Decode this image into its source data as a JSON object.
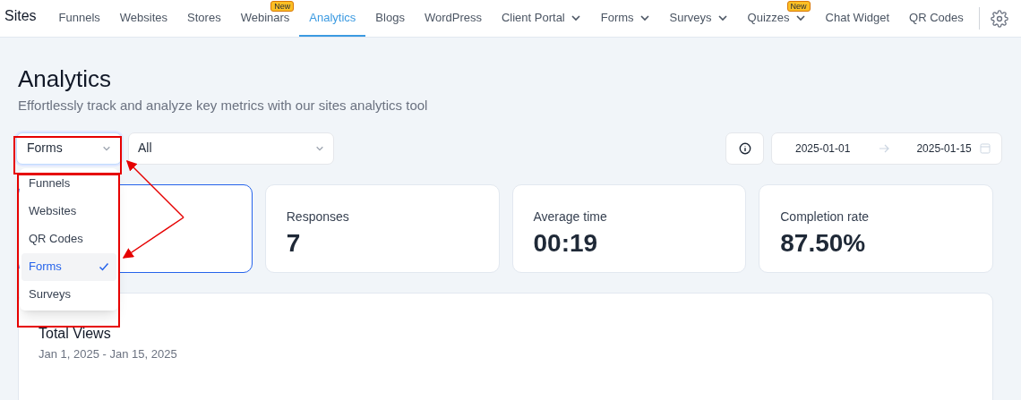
{
  "nav": {
    "brand": "Sites",
    "items": [
      {
        "label": "Funnels",
        "selected": false,
        "dropdown": false
      },
      {
        "label": "Websites",
        "selected": false,
        "dropdown": false
      },
      {
        "label": "Stores",
        "selected": false,
        "dropdown": false
      },
      {
        "label": "Webinars",
        "selected": false,
        "dropdown": false,
        "badge": "New"
      },
      {
        "label": "Analytics",
        "selected": true,
        "dropdown": false
      },
      {
        "label": "Blogs",
        "selected": false,
        "dropdown": false
      },
      {
        "label": "WordPress",
        "selected": false,
        "dropdown": false
      },
      {
        "label": "Client Portal",
        "selected": false,
        "dropdown": true
      },
      {
        "label": "Forms",
        "selected": false,
        "dropdown": true
      },
      {
        "label": "Surveys",
        "selected": false,
        "dropdown": true
      },
      {
        "label": "Quizzes",
        "selected": false,
        "dropdown": true,
        "badge": "New"
      },
      {
        "label": "Chat Widget",
        "selected": false,
        "dropdown": false
      },
      {
        "label": "QR Codes",
        "selected": false,
        "dropdown": false
      }
    ]
  },
  "page": {
    "title": "Analytics",
    "subtitle": "Effortlessly track and analyze key metrics with our sites analytics tool"
  },
  "filters": {
    "type_select": {
      "value": "Forms",
      "expanded": true,
      "options": [
        {
          "label": "Funnels",
          "selected": false
        },
        {
          "label": "Websites",
          "selected": false
        },
        {
          "label": "QR Codes",
          "selected": false
        },
        {
          "label": "Forms",
          "selected": true
        },
        {
          "label": "Surveys",
          "selected": false
        }
      ]
    },
    "item_select": {
      "value": "All"
    },
    "date_range": {
      "start": "2025-01-01",
      "end": "2025-01-15"
    }
  },
  "stats": [
    {
      "selected": true
    },
    {
      "label": "Responses",
      "value": "7",
      "selected": false
    },
    {
      "label": "Average time",
      "value": "00:19",
      "selected": false
    },
    {
      "label": "Completion rate",
      "value": "87.50%",
      "selected": false
    }
  ],
  "chart_card": {
    "title": "Total Views",
    "subtitle": "Jan 1, 2025 - Jan 15, 2025"
  }
}
